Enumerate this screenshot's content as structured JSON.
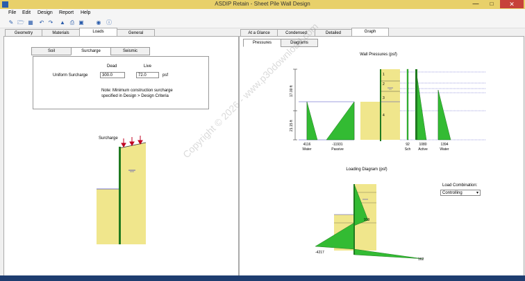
{
  "window": {
    "title": "ASDIP Retain - Sheet Pile Wall Design",
    "minimize": "—",
    "maximize": "□",
    "close": "✕"
  },
  "menu": [
    "File",
    "Edit",
    "Design",
    "Report",
    "Help"
  ],
  "toolbar": {
    "icons": [
      "new-icon",
      "open-icon",
      "save-icon",
      "undo-icon",
      "redo-icon",
      "zoom-icon",
      "print-icon",
      "preview-icon",
      "help-icon"
    ]
  },
  "left_tabs": [
    "Geometry",
    "Materials",
    "Loads",
    "General"
  ],
  "left_active_tab": "Loads",
  "load_subtabs": [
    "Soil",
    "Surcharge",
    "Seismic"
  ],
  "surcharge": {
    "dead_header": "Dead",
    "live_header": "Live",
    "row_label": "Uniform Surcharge",
    "dead_value": "300.0",
    "live_value": "72.0",
    "unit": "psf",
    "note": "Note: Minimum construction surcharge specified in Design > Design Criteria"
  },
  "left_sketch": {
    "surcharge_label": "Surcharge"
  },
  "right_tabs": [
    "At a Glance",
    "Condensed",
    "Detailed",
    "Graph"
  ],
  "right_active_tab": "Graph",
  "graph_subtabs": [
    "Pressures",
    "Diagrams"
  ],
  "wall_pressures": {
    "title": "Wall Pressures (psf)",
    "dim_upper": "17.00 ft",
    "dim_lower": "21.15 ft",
    "left_values": [
      {
        "value": "4116",
        "label": "Water"
      },
      {
        "value": "-11931",
        "label": "Passive"
      }
    ],
    "layers": [
      "1",
      "2",
      "3",
      "4"
    ],
    "right_values": [
      {
        "value": "92",
        "label": "Sch"
      },
      {
        "value": "1080",
        "label": "Active"
      },
      {
        "value": "1394",
        "label": "Water"
      }
    ]
  },
  "loading_diagram": {
    "title": "Loading Diagram (psf)",
    "value_mid": "919",
    "value_left": "-4217",
    "value_right": "16219"
  },
  "load_combination": {
    "label": "Load Combination:",
    "selected": "Controlling",
    "arrow": "▾"
  },
  "watermark": "Copyright © 2026 - www.p30download.com",
  "colors": {
    "soil_fill": "#f0e68c",
    "pressure_fill": "#33bb33",
    "water_line": "#4040c0",
    "accent": "#2a5cab"
  }
}
